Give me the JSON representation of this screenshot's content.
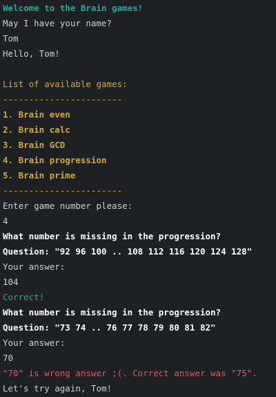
{
  "terminal": {
    "lines": [
      {
        "text": "Welcome to the Brain games!",
        "style": "teal bold"
      },
      {
        "text": "May I have your name?",
        "style": "plain"
      },
      {
        "text": "Tom",
        "style": "plain"
      },
      {
        "text": "Hello, Tom!",
        "style": "plain"
      },
      {
        "text": "",
        "style": "plain"
      },
      {
        "text": "List of available games:",
        "style": "gold"
      },
      {
        "text": "-----------------------",
        "style": "gold"
      },
      {
        "text": "1. Brain even",
        "style": "gold bold"
      },
      {
        "text": "2. Brain calc",
        "style": "gold bold"
      },
      {
        "text": "3. Brain GCD",
        "style": "gold bold"
      },
      {
        "text": "4. Brain progression",
        "style": "gold bold"
      },
      {
        "text": "5. Brain prime",
        "style": "gold bold"
      },
      {
        "text": "-----------------------",
        "style": "gold"
      },
      {
        "text": "Enter game number please:",
        "style": "plain"
      },
      {
        "text": "4",
        "style": "plain"
      },
      {
        "text": "What number is missing in the progression?",
        "style": "white bold"
      },
      {
        "text": "Question: \"92 96 100 .. 108 112 116 120 124 128\"",
        "style": "white bold"
      },
      {
        "text": "Your answer:",
        "style": "plain"
      },
      {
        "text": "104",
        "style": "plain"
      },
      {
        "text": "Correct!",
        "style": "teal"
      },
      {
        "text": "What number is missing in the progression?",
        "style": "white bold"
      },
      {
        "text": "Question: \"73 74 .. 76 77 78 79 80 81 82\"",
        "style": "white bold"
      },
      {
        "text": "Your answer:",
        "style": "plain"
      },
      {
        "text": "70",
        "style": "plain"
      },
      {
        "text": "\"70\" is wrong answer ;(. Correct answer was \"75\".",
        "style": "red"
      },
      {
        "text": "Let's try again, Tom!",
        "style": "plain"
      }
    ]
  }
}
